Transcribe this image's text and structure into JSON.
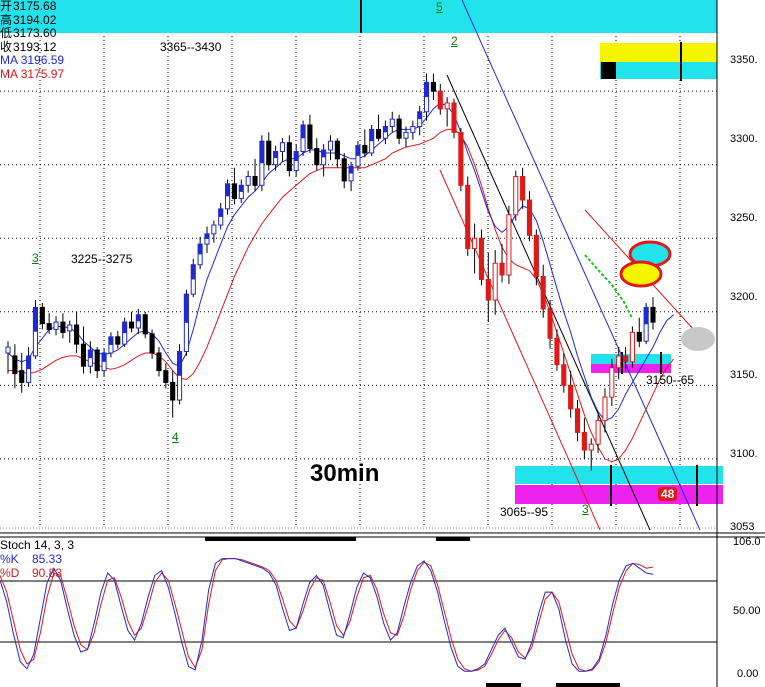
{
  "info": {
    "open_label": "开",
    "open": "3175.68",
    "high_label": "高",
    "high": "3194.02",
    "low_label": "低",
    "low": "3173.60",
    "close_label": "收",
    "close": "3193.12",
    "ma1_label": "MA",
    "ma1": "3196.59",
    "ma2_label": "MA",
    "ma2": "3175.97"
  },
  "annotations": {
    "range_top": "3365--3430",
    "range_left": "3225--3275",
    "range_mid": "3150--65",
    "range_bottom": "3065--95",
    "timeframe": "30min",
    "badge": "48"
  },
  "waves": {
    "w5": "5",
    "w2": "2",
    "w3a": "3",
    "w4": "4",
    "w3b": "3"
  },
  "axis": {
    "price_ticks": [
      "3350.",
      "3300.",
      "3250.",
      "3200.",
      "3150.",
      "3100."
    ],
    "last_price": "3053",
    "stoch_ticks": [
      "106.0",
      "50.00",
      "0.00"
    ]
  },
  "stoch": {
    "title": "Stoch",
    "params": "14, 3, 3",
    "k_label": "%K",
    "k": "85.33",
    "d_label": "%D",
    "d": "90.83"
  },
  "colors": {
    "up": "#1f2bd0",
    "down": "#e01818",
    "cyan": "#22e3ec",
    "yellow": "#f5f500",
    "magenta": "#ee22ee"
  },
  "chart_data": [
    {
      "type": "candlestick",
      "timeframe": "30min",
      "ylim": [
        3053,
        3412
      ],
      "ticks": [
        3100,
        3150,
        3200,
        3250,
        3300,
        3350
      ],
      "candles": [
        {
          "o": 3172,
          "h": 3180,
          "l": 3158,
          "c": 3176
        },
        {
          "o": 3170,
          "h": 3178,
          "l": 3148,
          "c": 3158
        },
        {
          "o": 3160,
          "h": 3172,
          "l": 3145,
          "c": 3152
        },
        {
          "o": 3152,
          "h": 3176,
          "l": 3149,
          "c": 3170
        },
        {
          "o": 3170,
          "h": 3208,
          "l": 3168,
          "c": 3203
        },
        {
          "o": 3203,
          "h": 3206,
          "l": 3188,
          "c": 3192
        },
        {
          "o": 3192,
          "h": 3199,
          "l": 3185,
          "c": 3188
        },
        {
          "o": 3188,
          "h": 3197,
          "l": 3184,
          "c": 3193
        },
        {
          "o": 3193,
          "h": 3199,
          "l": 3182,
          "c": 3186
        },
        {
          "o": 3187,
          "h": 3194,
          "l": 3179,
          "c": 3191
        },
        {
          "o": 3191,
          "h": 3200,
          "l": 3172,
          "c": 3178
        },
        {
          "o": 3178,
          "h": 3190,
          "l": 3158,
          "c": 3163
        },
        {
          "o": 3163,
          "h": 3180,
          "l": 3158,
          "c": 3174
        },
        {
          "o": 3174,
          "h": 3176,
          "l": 3155,
          "c": 3160
        },
        {
          "o": 3160,
          "h": 3175,
          "l": 3156,
          "c": 3172
        },
        {
          "o": 3172,
          "h": 3186,
          "l": 3169,
          "c": 3183
        },
        {
          "o": 3183,
          "h": 3187,
          "l": 3175,
          "c": 3178
        },
        {
          "o": 3178,
          "h": 3196,
          "l": 3176,
          "c": 3193
        },
        {
          "o": 3193,
          "h": 3200,
          "l": 3186,
          "c": 3189
        },
        {
          "o": 3189,
          "h": 3202,
          "l": 3185,
          "c": 3198
        },
        {
          "o": 3198,
          "h": 3200,
          "l": 3182,
          "c": 3185
        },
        {
          "o": 3185,
          "h": 3188,
          "l": 3168,
          "c": 3172
        },
        {
          "o": 3172,
          "h": 3176,
          "l": 3156,
          "c": 3160
        },
        {
          "o": 3160,
          "h": 3165,
          "l": 3148,
          "c": 3152
        },
        {
          "o": 3152,
          "h": 3160,
          "l": 3128,
          "c": 3140
        },
        {
          "o": 3140,
          "h": 3178,
          "l": 3137,
          "c": 3173
        },
        {
          "o": 3173,
          "h": 3215,
          "l": 3170,
          "c": 3212
        },
        {
          "o": 3212,
          "h": 3236,
          "l": 3210,
          "c": 3232
        },
        {
          "o": 3232,
          "h": 3251,
          "l": 3229,
          "c": 3246
        },
        {
          "o": 3246,
          "h": 3258,
          "l": 3240,
          "c": 3253
        },
        {
          "o": 3253,
          "h": 3262,
          "l": 3247,
          "c": 3259
        },
        {
          "o": 3259,
          "h": 3274,
          "l": 3256,
          "c": 3270
        },
        {
          "o": 3270,
          "h": 3290,
          "l": 3266,
          "c": 3287
        },
        {
          "o": 3287,
          "h": 3298,
          "l": 3273,
          "c": 3277
        },
        {
          "o": 3277,
          "h": 3290,
          "l": 3274,
          "c": 3286
        },
        {
          "o": 3286,
          "h": 3296,
          "l": 3281,
          "c": 3292
        },
        {
          "o": 3292,
          "h": 3304,
          "l": 3282,
          "c": 3286
        },
        {
          "o": 3286,
          "h": 3320,
          "l": 3282,
          "c": 3316
        },
        {
          "o": 3316,
          "h": 3322,
          "l": 3296,
          "c": 3300
        },
        {
          "o": 3300,
          "h": 3313,
          "l": 3296,
          "c": 3309
        },
        {
          "o": 3309,
          "h": 3318,
          "l": 3302,
          "c": 3315
        },
        {
          "o": 3315,
          "h": 3320,
          "l": 3292,
          "c": 3296
        },
        {
          "o": 3296,
          "h": 3314,
          "l": 3292,
          "c": 3309
        },
        {
          "o": 3309,
          "h": 3330,
          "l": 3306,
          "c": 3327
        },
        {
          "o": 3327,
          "h": 3334,
          "l": 3308,
          "c": 3311
        },
        {
          "o": 3311,
          "h": 3318,
          "l": 3296,
          "c": 3300
        },
        {
          "o": 3300,
          "h": 3314,
          "l": 3292,
          "c": 3310
        },
        {
          "o": 3310,
          "h": 3320,
          "l": 3303,
          "c": 3316
        },
        {
          "o": 3316,
          "h": 3318,
          "l": 3298,
          "c": 3304
        },
        {
          "o": 3304,
          "h": 3308,
          "l": 3284,
          "c": 3289
        },
        {
          "o": 3289,
          "h": 3302,
          "l": 3282,
          "c": 3299
        },
        {
          "o": 3299,
          "h": 3316,
          "l": 3296,
          "c": 3313
        },
        {
          "o": 3313,
          "h": 3324,
          "l": 3305,
          "c": 3308
        },
        {
          "o": 3308,
          "h": 3327,
          "l": 3306,
          "c": 3324
        },
        {
          "o": 3324,
          "h": 3334,
          "l": 3316,
          "c": 3318
        },
        {
          "o": 3318,
          "h": 3330,
          "l": 3314,
          "c": 3326
        },
        {
          "o": 3326,
          "h": 3336,
          "l": 3322,
          "c": 3331
        },
        {
          "o": 3331,
          "h": 3334,
          "l": 3314,
          "c": 3318
        },
        {
          "o": 3318,
          "h": 3326,
          "l": 3312,
          "c": 3322
        },
        {
          "o": 3322,
          "h": 3330,
          "l": 3317,
          "c": 3326
        },
        {
          "o": 3326,
          "h": 3340,
          "l": 3320,
          "c": 3336
        },
        {
          "o": 3336,
          "h": 3362,
          "l": 3330,
          "c": 3356
        },
        {
          "o": 3356,
          "h": 3362,
          "l": 3344,
          "c": 3350
        },
        {
          "o": 3350,
          "h": 3355,
          "l": 3334,
          "c": 3338
        },
        {
          "o": 3338,
          "h": 3346,
          "l": 3326,
          "c": 3342
        },
        {
          "o": 3342,
          "h": 3345,
          "l": 3318,
          "c": 3322
        },
        {
          "o": 3322,
          "h": 3325,
          "l": 3282,
          "c": 3286
        },
        {
          "o": 3286,
          "h": 3292,
          "l": 3238,
          "c": 3243
        },
        {
          "o": 3243,
          "h": 3260,
          "l": 3226,
          "c": 3250
        },
        {
          "o": 3250,
          "h": 3256,
          "l": 3218,
          "c": 3222
        },
        {
          "o": 3222,
          "h": 3240,
          "l": 3193,
          "c": 3208
        },
        {
          "o": 3208,
          "h": 3242,
          "l": 3198,
          "c": 3233
        },
        {
          "o": 3233,
          "h": 3246,
          "l": 3220,
          "c": 3225
        },
        {
          "o": 3225,
          "h": 3272,
          "l": 3219,
          "c": 3266
        },
        {
          "o": 3266,
          "h": 3296,
          "l": 3262,
          "c": 3292
        },
        {
          "o": 3292,
          "h": 3298,
          "l": 3270,
          "c": 3276
        },
        {
          "o": 3276,
          "h": 3282,
          "l": 3248,
          "c": 3252
        },
        {
          "o": 3252,
          "h": 3256,
          "l": 3218,
          "c": 3224
        },
        {
          "o": 3224,
          "h": 3232,
          "l": 3196,
          "c": 3202
        },
        {
          "o": 3202,
          "h": 3208,
          "l": 3175,
          "c": 3182
        },
        {
          "o": 3182,
          "h": 3188,
          "l": 3160,
          "c": 3164
        },
        {
          "o": 3164,
          "h": 3172,
          "l": 3145,
          "c": 3150
        },
        {
          "o": 3150,
          "h": 3160,
          "l": 3128,
          "c": 3134
        },
        {
          "o": 3134,
          "h": 3140,
          "l": 3112,
          "c": 3118
        },
        {
          "o": 3118,
          "h": 3128,
          "l": 3100,
          "c": 3106
        },
        {
          "o": 3106,
          "h": 3114,
          "l": 3092,
          "c": 3110
        },
        {
          "o": 3110,
          "h": 3130,
          "l": 3104,
          "c": 3126
        },
        {
          "o": 3126,
          "h": 3148,
          "l": 3118,
          "c": 3142
        },
        {
          "o": 3142,
          "h": 3168,
          "l": 3136,
          "c": 3162
        },
        {
          "o": 3162,
          "h": 3176,
          "l": 3154,
          "c": 3170
        },
        {
          "o": 3170,
          "h": 3176,
          "l": 3160,
          "c": 3166
        },
        {
          "o": 3166,
          "h": 3190,
          "l": 3162,
          "c": 3186
        },
        {
          "o": 3186,
          "h": 3196,
          "l": 3176,
          "c": 3180
        },
        {
          "o": 3180,
          "h": 3206,
          "l": 3178,
          "c": 3203
        },
        {
          "o": 3203,
          "h": 3210,
          "l": 3188,
          "c": 3193
        }
      ],
      "ma_fast": [
        3172,
        3168,
        3166,
        3168,
        3176,
        3182,
        3188,
        3190,
        3190,
        3189,
        3186,
        3180,
        3176,
        3172,
        3171,
        3172,
        3174,
        3178,
        3182,
        3186,
        3187,
        3185,
        3180,
        3172,
        3165,
        3163,
        3172,
        3188,
        3206,
        3222,
        3234,
        3246,
        3258,
        3266,
        3272,
        3278,
        3282,
        3288,
        3294,
        3298,
        3302,
        3304,
        3304,
        3308,
        3310,
        3310,
        3308,
        3308,
        3308,
        3306,
        3304,
        3304,
        3306,
        3310,
        3314,
        3318,
        3322,
        3324,
        3324,
        3324,
        3326,
        3332,
        3338,
        3342,
        3340,
        3334,
        3322,
        3308,
        3296,
        3282,
        3268,
        3258,
        3254,
        3258,
        3266,
        3272,
        3270,
        3262,
        3248,
        3232,
        3216,
        3200,
        3186,
        3170,
        3156,
        3142,
        3132,
        3126,
        3128,
        3134,
        3144,
        3152,
        3160,
        3168,
        3176,
        3186,
        3194,
        3198
      ],
      "ma_slow": [
        3160,
        3160,
        3159,
        3158,
        3159,
        3161,
        3164,
        3167,
        3169,
        3170,
        3170,
        3168,
        3166,
        3164,
        3162,
        3161,
        3162,
        3164,
        3167,
        3170,
        3172,
        3172,
        3170,
        3166,
        3160,
        3155,
        3154,
        3158,
        3166,
        3176,
        3188,
        3200,
        3212,
        3224,
        3234,
        3244,
        3252,
        3260,
        3266,
        3272,
        3278,
        3282,
        3286,
        3290,
        3294,
        3296,
        3298,
        3298,
        3298,
        3298,
        3298,
        3298,
        3298,
        3300,
        3302,
        3304,
        3308,
        3310,
        3312,
        3313,
        3314,
        3316,
        3318,
        3322,
        3324,
        3324,
        3320,
        3312,
        3300,
        3286,
        3270,
        3256,
        3244,
        3236,
        3232,
        3230,
        3228,
        3222,
        3212,
        3200,
        3186,
        3172,
        3158,
        3144,
        3130,
        3118,
        3108,
        3100,
        3098,
        3100,
        3106,
        3114,
        3124,
        3134,
        3144,
        3154,
        3162,
        3168
      ]
    },
    {
      "type": "line",
      "title": "Stoch 14, 3, 3",
      "ylim": [
        0,
        106
      ],
      "ticks": [
        0,
        50,
        106
      ],
      "series": [
        {
          "name": "%K",
          "values": [
            80,
            62,
            35,
            12,
            6,
            18,
            48,
            78,
            90,
            80,
            56,
            34,
            20,
            22,
            44,
            70,
            86,
            80,
            58,
            38,
            30,
            44,
            66,
            84,
            88,
            74,
            52,
            28,
            8,
            5,
            30,
            72,
            94,
            98,
            98,
            98,
            96,
            94,
            92,
            90,
            86,
            76,
            56,
            38,
            40,
            60,
            78,
            84,
            76,
            54,
            34,
            32,
            52,
            74,
            86,
            82,
            66,
            44,
            30,
            36,
            58,
            78,
            92,
            96,
            88,
            70,
            46,
            24,
            8,
            4,
            4,
            6,
            10,
            22,
            34,
            40,
            28,
            16,
            14,
            28,
            52,
            70,
            70,
            56,
            30,
            10,
            4,
            4,
            6,
            14,
            34,
            60,
            80,
            92,
            94,
            90,
            86,
            85
          ]
        },
        {
          "name": "%D",
          "values": [
            84,
            70,
            46,
            22,
            10,
            14,
            36,
            66,
            86,
            84,
            64,
            42,
            26,
            22,
            36,
            60,
            80,
            82,
            66,
            46,
            34,
            40,
            58,
            78,
            86,
            80,
            60,
            38,
            16,
            7,
            22,
            60,
            88,
            97,
            98,
            98,
            97,
            95,
            93,
            91,
            88,
            80,
            64,
            46,
            40,
            54,
            72,
            82,
            80,
            62,
            42,
            34,
            46,
            66,
            82,
            84,
            72,
            52,
            36,
            34,
            50,
            72,
            88,
            95,
            92,
            76,
            54,
            32,
            14,
            6,
            4,
            5,
            8,
            18,
            30,
            38,
            32,
            20,
            15,
            24,
            44,
            64,
            70,
            62,
            40,
            18,
            6,
            4,
            5,
            12,
            28,
            52,
            74,
            88,
            94,
            93,
            90,
            91
          ]
        }
      ]
    }
  ]
}
